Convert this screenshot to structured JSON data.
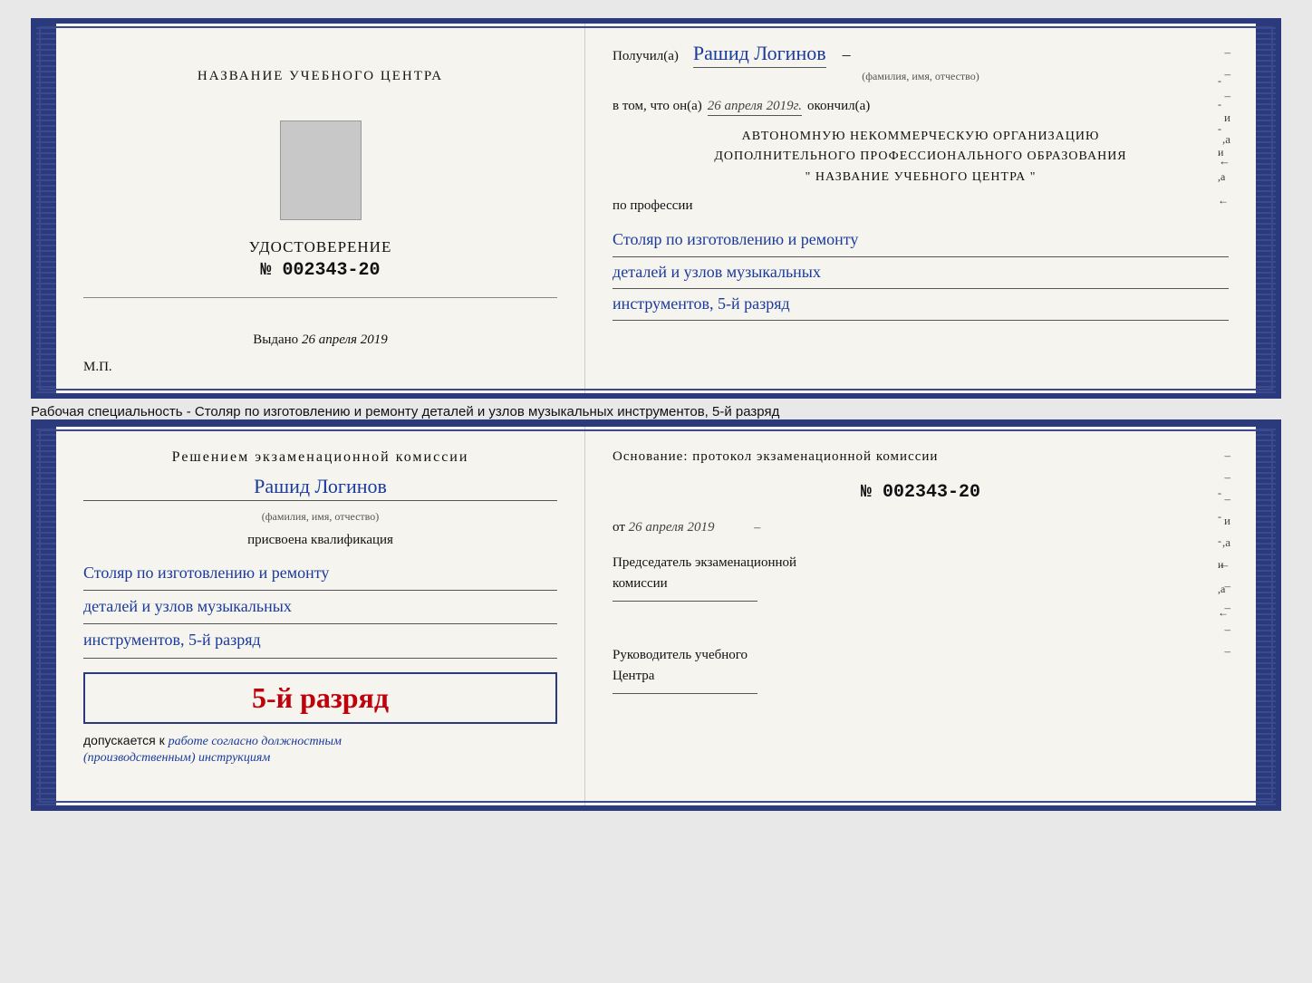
{
  "top_doc": {
    "left": {
      "center_title": "НАЗВАНИЕ УЧЕБНОГО ЦЕНТРА",
      "photo_alt": "фото",
      "udostoverenie": "УДОСТОВЕРЕНИЕ",
      "number_label": "№",
      "number": "002343-20",
      "vydano_label": "Выдано",
      "vydano_date": "26 апреля 2019",
      "mp_label": "М.П."
    },
    "right": {
      "poluchil_label": "Получил(a)",
      "recipient_name": "Рашид Логинов",
      "fio_hint": "(фамилия, имя, отчество)",
      "vtom_label": "в том, что он(а)",
      "date_value": "26 апреля 2019г.",
      "okончил_label": "окончил(а)",
      "org_line1": "АВТОНОМНУЮ НЕКОММЕРЧЕСКУЮ ОРГАНИЗАЦИЮ",
      "org_line2": "ДОПОЛНИТЕЛЬНОГО ПРОФЕССИОНАЛЬНОГО ОБРАЗОВАНИЯ",
      "org_line3": "\" НАЗВАНИЕ УЧЕБНОГО ЦЕНТРА \"",
      "po_professii": "по профессии",
      "profession_line1": "Столяр по изготовлению и ремонту",
      "profession_line2": "деталей и узлов музыкальных",
      "profession_line3": "инструментов, 5-й разряд"
    }
  },
  "caption": {
    "text": "Рабочая специальность - Столяр по изготовлению и ремонту деталей и узлов музыкальных инструментов, 5-й разряд"
  },
  "bottom_doc": {
    "left": {
      "resheniem_label": "Решением экзаменационной комиссии",
      "name": "Рашид Логинов",
      "fio_hint": "(фамилия, имя, отчество)",
      "prisvoena": "присвоена квалификация",
      "profession_line1": "Столяр по изготовлению и ремонту",
      "profession_line2": "деталей и узлов музыкальных",
      "profession_line3": "инструментов, 5-й разряд",
      "rank_text": "5-й разряд",
      "dopuskaetsya": "допускается к",
      "work_instruction": "работе согласно должностным",
      "work_instruction2": "(производственным) инструкциям"
    },
    "right": {
      "osnovaniye_label": "Основание: протокол экзаменационной комиссии",
      "number_label": "№",
      "number": "002343-20",
      "ot_label": "от",
      "ot_date": "26 апреля 2019",
      "predsedatel_line1": "Председатель экзаменационной",
      "predsedatel_line2": "комиссии",
      "rukovoditel_line1": "Руководитель учебного",
      "rukovoditel_line2": "Центра",
      "right_dashes": "–\n–\n–\nи\n,а\n←\n–\n–\n–\n–"
    }
  }
}
